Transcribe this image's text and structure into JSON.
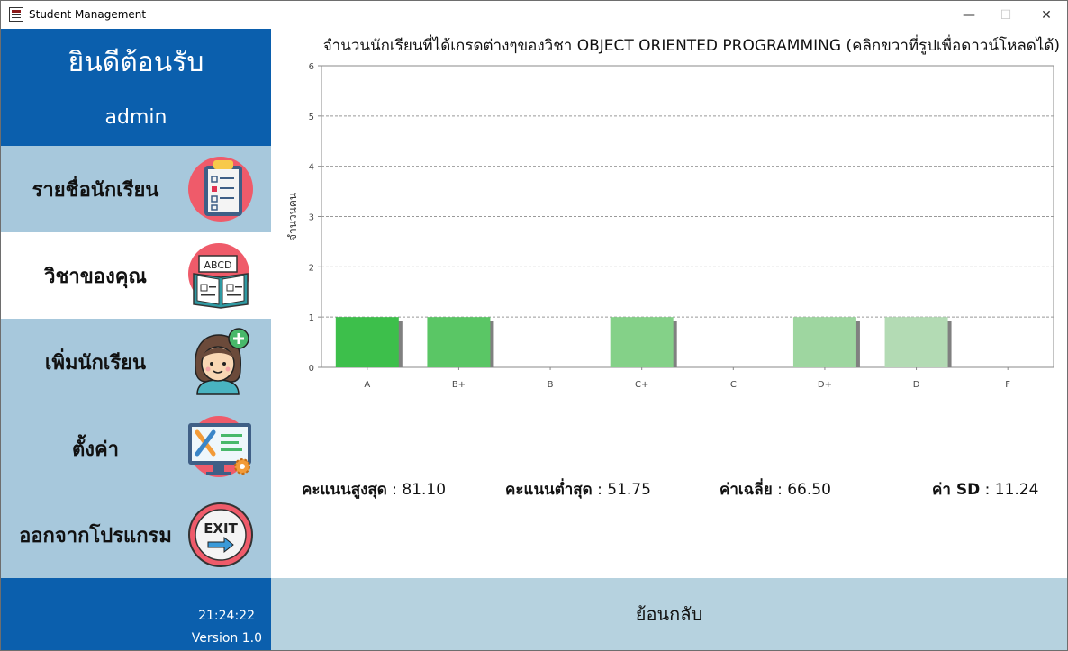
{
  "window": {
    "title": "Student Management",
    "controls": {
      "minimize": "—",
      "maximize": "☐",
      "close": "✕"
    }
  },
  "sidebar": {
    "welcome_title": "ยินดีต้อนรับ",
    "username": "admin",
    "items": [
      {
        "label": "รายชื่อนักเรียน",
        "icon": "clipboard-checklist-icon",
        "active": false
      },
      {
        "label": "วิชาของคุณ",
        "icon": "open-book-abcd-icon",
        "active": true
      },
      {
        "label": "เพิ่มนักเรียน",
        "icon": "add-student-icon",
        "active": false
      },
      {
        "label": "ตั้งค่า",
        "icon": "settings-tools-icon",
        "active": false
      },
      {
        "label": "ออกจากโปรแกรม",
        "icon": "exit-sign-icon",
        "active": false
      }
    ],
    "clock": "21:24:22",
    "version": "Version 1.0"
  },
  "main": {
    "chart_title": "จำนวนนักเรียนที่ได้เกรดต่างๆของวิชา OBJECT ORIENTED PROGRAMMING (คลิกขวาที่รูปเพื่อดาวน์โหลดได้)",
    "stats": [
      {
        "label": "คะแนนสูงสุด",
        "value": "81.10"
      },
      {
        "label": "คะแนนต่ำสุด",
        "value": "51.75"
      },
      {
        "label": "ค่าเฉลี่ย",
        "value": "66.50"
      },
      {
        "label": "ค่า SD",
        "value": "11.24"
      }
    ],
    "back_label": "ย้อนกลับ"
  },
  "colors": {
    "sidebar_dark": "#0b5fad",
    "sidebar_light": "#a7c8dc",
    "back_bar": "#b6d2df",
    "bar_colors": [
      "#3dbf4b",
      "#5ac665",
      "#5ac665",
      "#84d188",
      "#84d188",
      "#9ed6a0",
      "#b3dbb4",
      "#b3dbb4"
    ]
  },
  "chart_data": {
    "type": "bar",
    "title": "จำนวนนักเรียนที่ได้เกรดต่างๆของวิชา OBJECT ORIENTED PROGRAMMING (คลิกขวาที่รูปเพื่อดาวน์โหลดได้)",
    "xlabel": "",
    "ylabel": "จำนวนคน",
    "categories": [
      "A",
      "B+",
      "B",
      "C+",
      "C",
      "D+",
      "D",
      "F"
    ],
    "values": [
      1,
      1,
      0,
      1,
      0,
      1,
      1,
      0
    ],
    "ylim": [
      0,
      6
    ],
    "yticks": [
      0,
      1,
      2,
      3,
      4,
      5,
      6
    ],
    "grid": true,
    "legend": "none"
  }
}
